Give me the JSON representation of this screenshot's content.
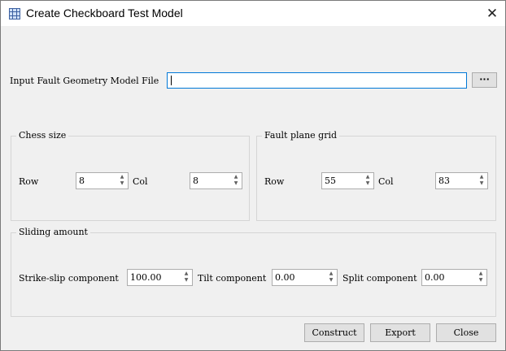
{
  "window": {
    "title": "Create Checkboard Test Model",
    "close_glyph": "✕",
    "icon": "grid-icon"
  },
  "file": {
    "label": "Input Fault Geometry Model File",
    "value": "",
    "browse_label": "···"
  },
  "chess_size": {
    "title": "Chess size",
    "row_label": "Row",
    "row_value": "8",
    "col_label": "Col",
    "col_value": "8"
  },
  "fault_plane_grid": {
    "title": "Fault plane grid",
    "row_label": "Row",
    "row_value": "55",
    "col_label": "Col",
    "col_value": "83"
  },
  "sliding": {
    "title": "Sliding amount",
    "strike_label": "Strike-slip component",
    "strike_value": "100.00",
    "tilt_label": "Tilt component",
    "tilt_value": "0.00",
    "split_label": "Split component",
    "split_value": "0.00"
  },
  "buttons": {
    "construct": "Construct",
    "export": "Export",
    "close": "Close"
  },
  "spin_arrows": {
    "up": "▲",
    "down": "▼"
  },
  "colors": {
    "focus_border": "#0078d7",
    "button_bg": "#e1e1e1",
    "window_bg": "#f0f0f0"
  }
}
